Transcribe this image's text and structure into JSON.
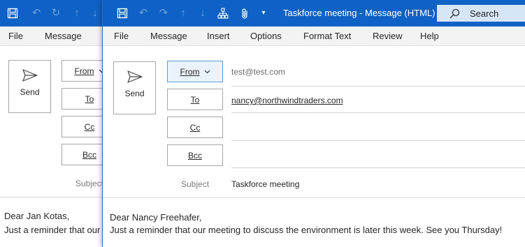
{
  "back_window": {
    "menu": [
      "File",
      "Message"
    ],
    "send_label": "Send",
    "from_label": "From",
    "to_label": "To",
    "cc_label": "Cc",
    "bcc_label": "Bcc",
    "subject_label": "Subject",
    "body": [
      "Dear Jan Kotas,",
      "Just a reminder that our"
    ]
  },
  "front_window": {
    "title": "Taskforce meeting  -  Message (HTML)",
    "search_label": "Search",
    "menu": [
      "File",
      "Message",
      "Insert",
      "Options",
      "Format Text",
      "Review",
      "Help"
    ],
    "send_label": "Send",
    "from_label": "From",
    "to_label": "To",
    "cc_label": "Cc",
    "bcc_label": "Bcc",
    "from_value": "test@test.com",
    "to_value": "nancy@northwindtraders.com",
    "cc_value": "",
    "bcc_value": "",
    "subject_label": "Subject",
    "subject_value": "Taskforce meeting",
    "body": [
      "Dear Nancy Freehafer,",
      "Just a reminder that our meeting to discuss the environment is later this week. See you Thursday!"
    ]
  },
  "quick_access_icons": [
    "save-icon",
    "undo-icon",
    "redo-icon",
    "up-arrow-icon",
    "down-arrow-icon",
    "hierarchy-icon",
    "attach-icon",
    "customize-dropdown-icon"
  ],
  "colors": {
    "titlebar": "#0f62c5",
    "menubar": "#f3f3f3",
    "search_box": "#d7e6f7",
    "button_border": "#a6a6a6",
    "active_button": "#eaf2fb"
  }
}
